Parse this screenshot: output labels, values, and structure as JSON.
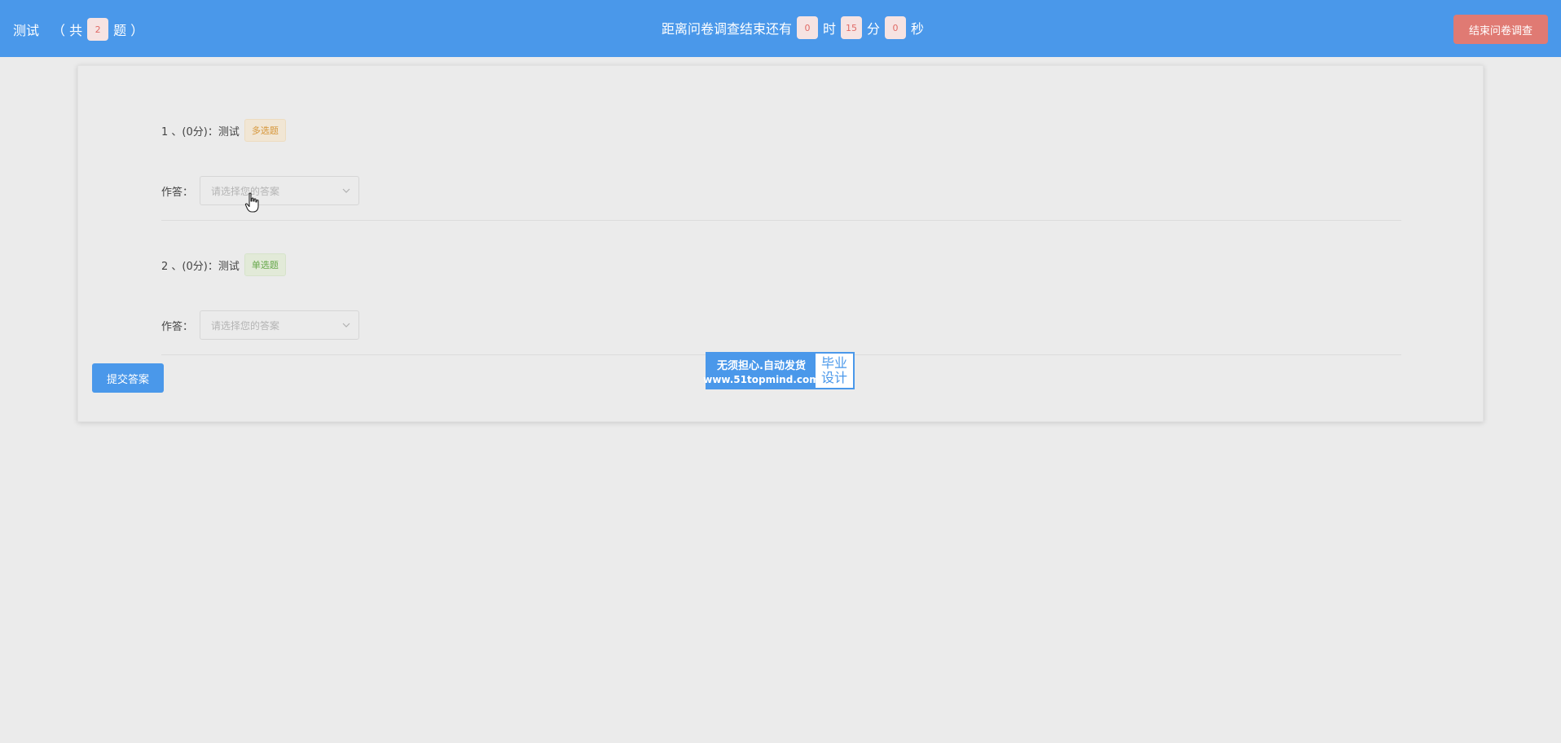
{
  "header": {
    "survey_title": "测试",
    "count_prefix": "（ 共",
    "question_count": "2",
    "count_suffix": "题 ）",
    "timer_prefix": "距离问卷调查结束还有",
    "hours": "0",
    "hours_unit": "时",
    "minutes": "15",
    "minutes_unit": "分",
    "seconds": "0",
    "seconds_unit": "秒",
    "end_button": "结束问卷调查"
  },
  "questions": [
    {
      "title": "1 、(0分)：测试",
      "tag": "多选题",
      "answer_label": "作答：",
      "placeholder": "请选择您的答案"
    },
    {
      "title": "2 、(0分)：测试",
      "tag": "单选题",
      "answer_label": "作答：",
      "placeholder": "请选择您的答案"
    }
  ],
  "submit_button": "提交答案",
  "ad": {
    "line1": "无须担心.自动发货",
    "line2": "www.51topmind.com",
    "right_line1": "毕业",
    "right_line2": "设计"
  },
  "colors": {
    "header_bg": "#4a98ea",
    "end_button": "#e07a73",
    "tag_multi": "#d6963a",
    "tag_single": "#67a84b"
  },
  "icons": {
    "select_arrow": "chevron-down-icon",
    "cursor": "hand-pointer-icon"
  }
}
